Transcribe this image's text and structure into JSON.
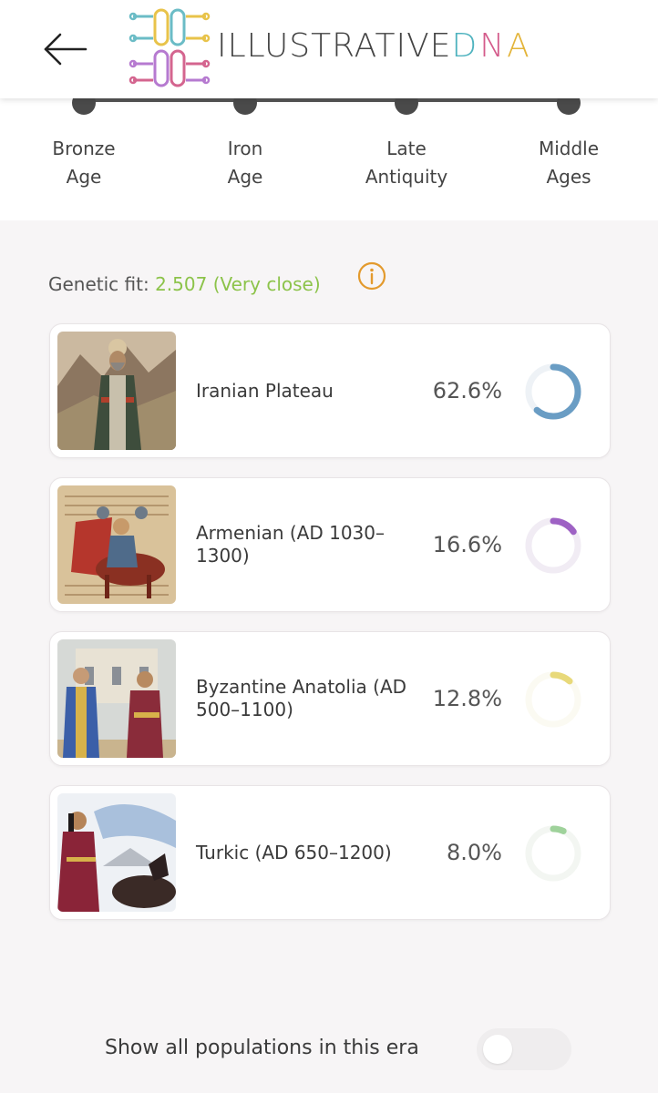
{
  "header": {
    "back_icon": "arrow-left-icon",
    "logo_text_main": "ILLUSTRATIVE",
    "logo_text_d": "D",
    "logo_text_n": "N",
    "logo_text_a": "A"
  },
  "timeline": {
    "eras": [
      {
        "line1": "Bronze",
        "line2": "Age"
      },
      {
        "line1": "Iron",
        "line2": "Age"
      },
      {
        "line1": "Late",
        "line2": "Antiquity"
      },
      {
        "line1": "Middle",
        "line2": "Ages"
      }
    ]
  },
  "fit": {
    "label": "Genetic fit:",
    "value": "2.507 (Very close)",
    "info_icon": "info-icon",
    "color": "#8cc34a"
  },
  "populations": [
    {
      "name": "Iranian Plateau",
      "percent": "62.6%",
      "fraction": 0.626,
      "color": "#6a9dc4",
      "track": "#eef2f6",
      "image": "iranian-plateau-illustration"
    },
    {
      "name": "Armenian (AD 1030–1300)",
      "percent": "16.6%",
      "fraction": 0.166,
      "color": "#9e62c4",
      "track": "#f1ecf4",
      "image": "armenian-illustration"
    },
    {
      "name": "Byzantine Anatolia (AD 500–1100)",
      "percent": "12.8%",
      "fraction": 0.128,
      "color": "#e8d97a",
      "track": "#fbfaf2",
      "image": "byzantine-anatolia-illustration"
    },
    {
      "name": "Turkic (AD 650–1200)",
      "percent": "8.0%",
      "fraction": 0.08,
      "color": "#9fd29b",
      "track": "#f3f6f2",
      "image": "turkic-illustration"
    }
  ],
  "toggle": {
    "label": "Show all populations in this era",
    "on": false
  }
}
